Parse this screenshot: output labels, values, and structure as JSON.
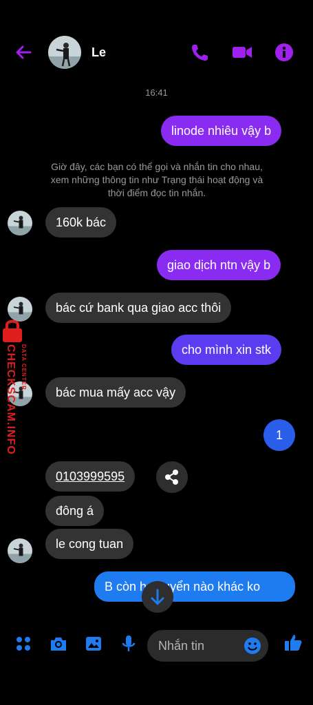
{
  "header": {
    "contact_name": "Le"
  },
  "conversation": {
    "time": "16:41",
    "info_note": "Giờ đây, các bạn có thể gọi và nhắn tin cho nhau, xem những thông tin như Trạng thái hoạt động và thời điểm đọc tin nhắn.",
    "messages": [
      {
        "from": "me",
        "text": "linode nhiêu vậy b"
      },
      {
        "from": "them",
        "text": "160k bác"
      },
      {
        "from": "me",
        "text": "giao dịch ntn vậy b"
      },
      {
        "from": "them",
        "text": "bác cứ bank qua giao acc thôi"
      },
      {
        "from": "me",
        "text": "cho mình xin stk"
      },
      {
        "from": "them",
        "text": "bác mua mấy acc vậy"
      },
      {
        "from": "me",
        "text": "1"
      },
      {
        "from": "them",
        "text": "0103999595"
      },
      {
        "from": "them",
        "text": "đông á"
      },
      {
        "from": "them",
        "text": "le cong tuan"
      },
      {
        "from": "me",
        "text": "B còn     h chuyển nào khác ko"
      }
    ]
  },
  "composer": {
    "placeholder": "Nhắn tin"
  },
  "watermark": {
    "text": "CHECKSCAM.INFO",
    "sub": "DATA CENTER"
  },
  "colors": {
    "purple": "#8a2bf2",
    "blue": "#2b5ee8",
    "icon_blue": "#1e7bf0",
    "icon_purple": "#a020f0"
  },
  "icons": [
    "back-arrow-icon",
    "phone-icon",
    "video-icon",
    "info-icon",
    "apps-icon",
    "camera-icon",
    "image-icon",
    "microphone-icon",
    "emoji-icon",
    "like-icon",
    "share-icon",
    "arrow-down-icon"
  ]
}
